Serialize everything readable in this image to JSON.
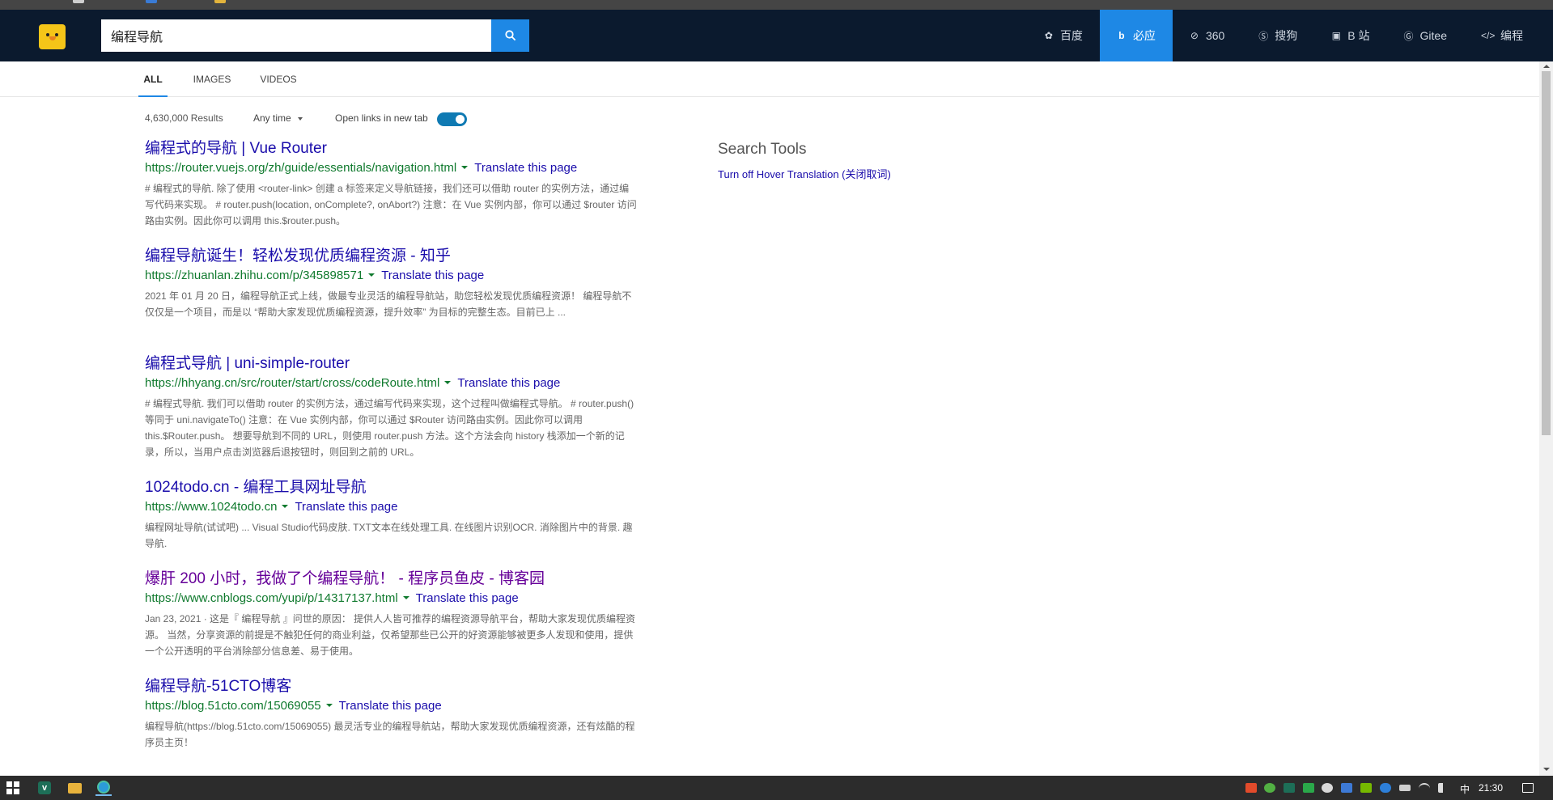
{
  "search": {
    "value": "编程导航"
  },
  "engines": [
    {
      "label": "百度",
      "icon": "baidu-paw-icon",
      "active": false
    },
    {
      "label": "必应",
      "icon": "bing-icon",
      "active": true
    },
    {
      "label": "360",
      "icon": "360-icon",
      "active": false
    },
    {
      "label": "搜狗",
      "icon": "sogou-icon",
      "active": false
    },
    {
      "label": "B 站",
      "icon": "bilibili-icon",
      "active": false
    },
    {
      "label": "Gitee",
      "icon": "gitee-icon",
      "active": false
    },
    {
      "label": "编程",
      "icon": "code-icon",
      "active": false
    }
  ],
  "tabs": [
    {
      "label": "ALL",
      "active": true
    },
    {
      "label": "IMAGES",
      "active": false
    },
    {
      "label": "VIDEOS",
      "active": false
    }
  ],
  "meta": {
    "results_count": "4,630,000 Results",
    "time_filter": "Any time",
    "open_links_label": "Open links in new tab",
    "open_links_enabled": true
  },
  "results": [
    {
      "title": "编程式的导航 | Vue Router",
      "url": "https://router.vuejs.org/zh/guide/essentials/navigation.html",
      "translate": "Translate this page",
      "snippet": "# 编程式的导航. 除了使用 <router-link> 创建 a 标签来定义导航链接，我们还可以借助 router 的实例方法，通过编写代码来实现。 # router.push(location, onComplete?, onAbort?) 注意：在 Vue 实例内部，你可以通过 $router 访问路由实例。因此你可以调用 this.$router.push。",
      "visited": false
    },
    {
      "title": "编程导航诞生！轻松发现优质编程资源 - 知乎",
      "url": "https://zhuanlan.zhihu.com/p/345898571",
      "translate": "Translate this page",
      "snippet": "2021 年 01 月 20 日，编程导航正式上线，做最专业灵活的编程导航站，助您轻松发现优质编程资源！ 编程导航不仅仅是一个项目，而是以 “帮助大家发现优质编程资源，提升效率” 为目标的完整生态。目前已上 ...",
      "visited": false
    },
    {
      "title": "编程式导航 | uni-simple-router",
      "url": "https://hhyang.cn/src/router/start/cross/codeRoute.html",
      "translate": "Translate this page",
      "snippet": "# 编程式导航. 我们可以借助 router 的实例方法，通过编写代码来实现，这个过程叫做编程式导航。 # router.push() 等同于 uni.navigateTo() 注意：在 Vue 实例内部，你可以通过 $Router 访问路由实例。因此你可以调用 this.$Router.push。 想要导航到不同的 URL，则使用 router.push 方法。这个方法会向 history 栈添加一个新的记录，所以，当用户点击浏览器后退按钮时，则回到之前的 URL。",
      "visited": false
    },
    {
      "title": "1024todo.cn - 编程工具网址导航",
      "url": "https://www.1024todo.cn",
      "translate": "Translate this page",
      "snippet": "编程网址导航(试试吧) ... Visual Studio代码皮肤. TXT文本在线处理工具. 在线图片识别OCR. 消除图片中的背景. 趣导航.",
      "visited": false
    },
    {
      "title": "爆肝 200 小时，我做了个编程导航！ - 程序员鱼皮 - 博客园",
      "url": "https://www.cnblogs.com/yupi/p/14317137.html",
      "translate": "Translate this page",
      "snippet": "Jan 23, 2021 · 这是『 编程导航 』问世的原因： 提供人人皆可推荐的编程资源导航平台，帮助大家发现优质编程资源。 当然，分享资源的前提是不触犯任何的商业利益，仅希望那些已公开的好资源能够被更多人发现和使用，提供一个公开透明的平台消除部分信息差、易于使用。",
      "visited": true
    },
    {
      "title": "编程导航-51CTO博客",
      "url": "https://blog.51cto.com/15069055",
      "translate": "Translate this page",
      "snippet": "编程导航(https://blog.51cto.com/15069055) 最灵活专业的编程导航站，帮助大家发现优质编程资源，还有炫酷的程序员主页！",
      "visited": false
    }
  ],
  "side": {
    "title": "Search Tools",
    "link": "Turn off Hover Translation (关闭取词)"
  },
  "taskbar": {
    "ime": "中",
    "time": "21:30"
  },
  "colors": {
    "header_bg": "#0b1a2e",
    "accent": "#1e88e5",
    "link": "#1a0dab",
    "url_green": "#107a2e"
  }
}
